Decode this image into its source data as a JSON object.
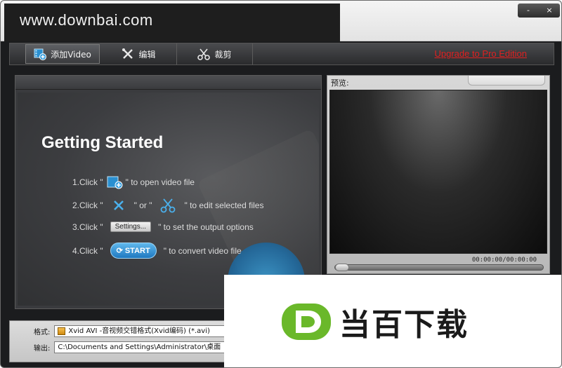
{
  "watermark": {
    "url": "www.downbai.com",
    "brand": "当百下载"
  },
  "window_controls": {
    "minimize": "-",
    "close": "×"
  },
  "toolbar": {
    "add_video": "添加Video",
    "edit": "编辑",
    "trim": "裁剪",
    "upgrade_link": "Upgrade to Pro Edition"
  },
  "getting_started": {
    "title": "Getting Started",
    "step1": {
      "prefix": "1.Click \"",
      "suffix": "\" to open video file"
    },
    "step2": {
      "prefix": "2.Click \"",
      "middle": "\" or \"",
      "suffix": "\" to edit selected files"
    },
    "step3": {
      "prefix": "3.Click \"",
      "button": "Settings...",
      "suffix": "\" to set the output options"
    },
    "step4": {
      "prefix": "4.Click \"",
      "button": "START",
      "suffix": "\" to convert video file"
    }
  },
  "preview": {
    "label": "预览:",
    "timecode": "00:00:00/00:00:00",
    "seek_progress": 0
  },
  "output": {
    "format_label": "格式:",
    "format_value": "Xvid AVI -音视频交错格式(Xvid编码) (*.avi)",
    "path_label": "输出:",
    "path_value": "C:\\Documents and Settings\\Administrator\\桌面"
  },
  "colors": {
    "upgrade_link": "#e02020",
    "brand_green": "#6ab82a",
    "start_blue": "#1f78c0"
  }
}
